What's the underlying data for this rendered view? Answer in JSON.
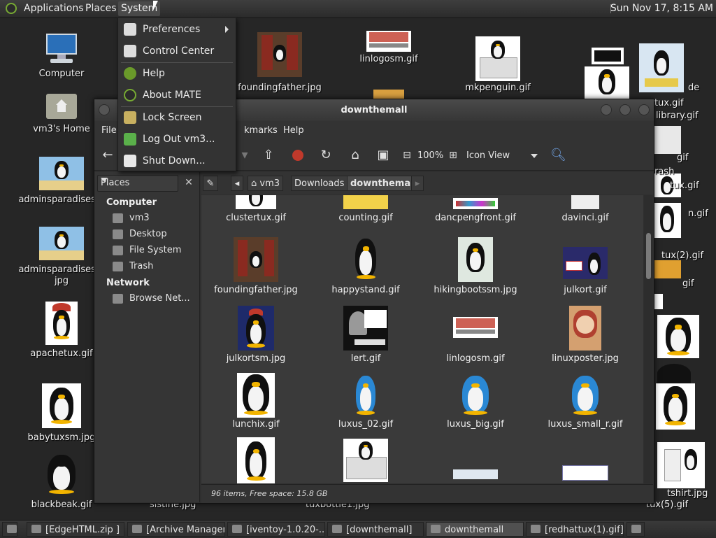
{
  "top_panel": {
    "menus": [
      "Applications",
      "Places",
      "System"
    ],
    "clock": "Sun Nov 17,  8:15 AM"
  },
  "system_menu": {
    "items": [
      {
        "label": "Preferences",
        "icon": "preferences-icon",
        "submenu": true
      },
      {
        "label": "Control Center",
        "icon": "control-center-icon"
      },
      {
        "label": "Help",
        "icon": "help-icon"
      },
      {
        "label": "About MATE",
        "icon": "mate-logo-icon"
      },
      {
        "label": "Lock Screen",
        "icon": "lock-icon"
      },
      {
        "label": "Log Out vm3...",
        "icon": "logout-icon"
      },
      {
        "label": "Shut Down...",
        "icon": "shutdown-icon"
      }
    ]
  },
  "desktop": {
    "left_icons": [
      "Computer",
      "vm3's Home",
      "adminsparadisesm",
      "adminsparadisesm\njpg",
      "apachetux.gif",
      "babytuxsm.jpg",
      "blackbeak.gif"
    ],
    "top_icons": [
      "foundingfather.jpg",
      "linlogosm.gif",
      "mkpenguin.gif"
    ],
    "bottom_labels": [
      "sistine.jpg",
      "tuxbottle1.jpg"
    ],
    "right_fragments": [
      "tux.gif",
      "library.gif",
      "de",
      "gif",
      "tux.gif",
      "rash",
      "jpg",
      "tux(2).gif",
      "n.gif",
      "gif",
      "tshirt.jpg",
      "tux(5).gif"
    ]
  },
  "window": {
    "title": "downthemall",
    "menubar": [
      "File",
      "kmarks",
      "Help"
    ],
    "toolbar": {
      "zoom": "100%",
      "view": "Icon View"
    },
    "sidebar": {
      "combo": "Places",
      "computer_header": "Computer",
      "computer_items": [
        "vm3",
        "Desktop",
        "File System",
        "Trash"
      ],
      "network_header": "Network",
      "network_items": [
        "Browse Net..."
      ]
    },
    "path": [
      "vm3",
      "Downloads",
      "downthemall"
    ],
    "files_row0": [
      "clustertux.gif",
      "counting.gif",
      "dancpengfront.gif",
      "davinci.gif"
    ],
    "files_row1": [
      "foundingfather.jpg",
      "happystand.gif",
      "hikingbootssm.jpg",
      "julkort.gif"
    ],
    "files_row2": [
      "julkortsm.jpg",
      "lert.gif",
      "linlogosm.gif",
      "linuxposter.jpg"
    ],
    "files_row3": [
      "lunchix.gif",
      "luxus_02.gif",
      "luxus_big.gif",
      "luxus_small_r.gif"
    ],
    "status": "96 items, Free space: 15.8 GB"
  },
  "taskbar": {
    "items": [
      "[EdgeHTML.zip ]",
      "[Archive Manager]",
      "[iventoy-1.0.20-...",
      "[downthemall]",
      "downthemall",
      "[redhattux(1).gif]"
    ]
  },
  "colors": {
    "accent": "#77aa33",
    "panel": "#2b2b2b",
    "window": "#3a3a3a"
  }
}
